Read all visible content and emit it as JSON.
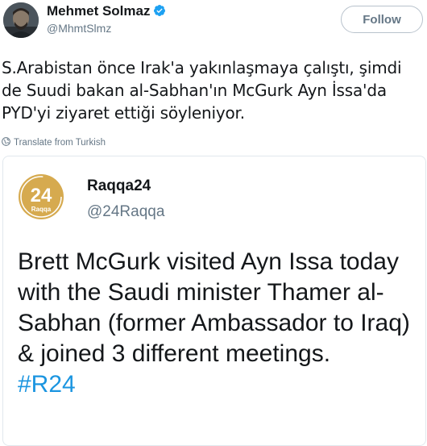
{
  "tweet": {
    "author": {
      "display_name": "Mehmet Solmaz",
      "handle": "@MhmtSlmz",
      "verified": true
    },
    "follow_label": "Follow",
    "text": "S.Arabistan önce Irak'a yakınlaşmaya çalıştı, şimdi de Suudi bakan al-Sabhan'ın McGurk Ayn İssa'da PYD'yi ziyaret ettiği söyleniyor.",
    "translate_label": "Translate from Turkish"
  },
  "quoted": {
    "display_name": "Raqqa24",
    "handle": "@24Raqqa",
    "logo_number": "24",
    "logo_text": "Raqqa",
    "text": "Brett McGurk visited Ayn Issa today with the Saudi minister Thamer al-Sabhan (former Ambassador to Iraq) & joined 3 different meetings.",
    "hashtag": "#R24"
  },
  "colors": {
    "link": "#1b95e0",
    "verified": "#1da1f2",
    "secondary_text": "#657786",
    "logo_gold": "#d6aa4f"
  }
}
